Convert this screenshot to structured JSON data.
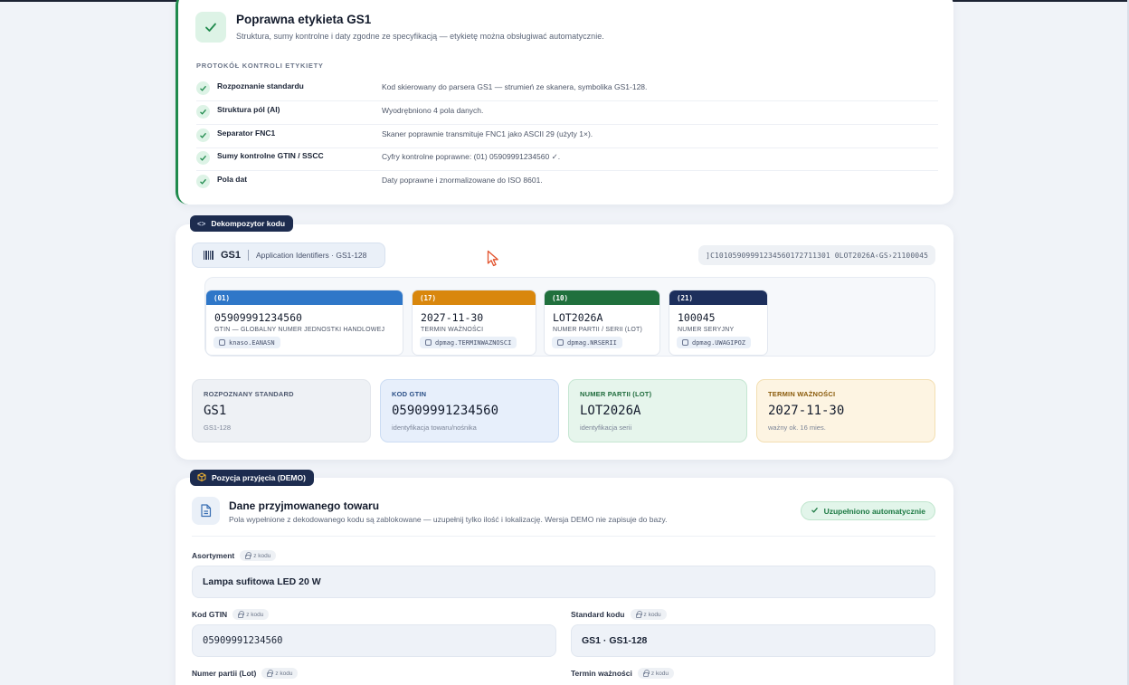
{
  "validation": {
    "title": "Poprawna etykieta GS1",
    "subtitle": "Struktura, sumy kontrolne i daty zgodne ze specyfikacją — etykietę można obsługiwać automatycznie.",
    "protocol_label": "PROTOKÓŁ KONTROLI ETYKIETY",
    "checks": [
      {
        "name": "Rozpoznanie standardu",
        "desc": "Kod skierowany do parsera GS1 — strumień ze skanera, symbolika GS1-128."
      },
      {
        "name": "Struktura pól (AI)",
        "desc": "Wyodrębniono 4 pola danych."
      },
      {
        "name": "Separator FNC1",
        "desc": "Skaner poprawnie transmituje FNC1 jako ASCII 29 (użyty 1×)."
      },
      {
        "name": "Sumy kontrolne GTIN / SSCC",
        "desc": "Cyfry kontrolne poprawne: (01) 05909991234560 ✓."
      },
      {
        "name": "Pola dat",
        "desc": "Daty poprawne i znormalizowane do ISO 8601."
      }
    ]
  },
  "decoder": {
    "pill": "Dekompozytor kodu",
    "standard": "GS1",
    "standard_desc": "Application Identifiers · GS1-128",
    "raw": "]C10105909991234560172711301 0LOT2026A‹GS›21100045",
    "ais": [
      {
        "ai": "(01)",
        "value": "05909991234560",
        "label": "GTIN — GLOBALNY NUMER JEDNOSTKI HANDLOWEJ",
        "field": "knaso.EANASN",
        "color": "#2f77c8"
      },
      {
        "ai": "(17)",
        "value": "2027-11-30",
        "label": "TERMIN WAŻNOŚCI",
        "field": "dpmag.TERMINWAZNOSCI",
        "color": "#d9870d"
      },
      {
        "ai": "(10)",
        "value": "LOT2026A",
        "label": "NUMER PARTII / SERII (LOT)",
        "field": "dpmag.NRSERII",
        "color": "#20703d"
      },
      {
        "ai": "(21)",
        "value": "100045",
        "label": "NUMER SERYJNY",
        "field": "dpmag.UWAGIPOZ",
        "color": "#1d2f5c"
      }
    ],
    "summary": [
      {
        "title": "ROZPOZNANY STANDARD",
        "value": "GS1",
        "sub": "GS1-128"
      },
      {
        "title": "KOD GTIN",
        "value": "05909991234560",
        "sub": "identyfikacja towaru/nośnika"
      },
      {
        "title": "NUMER PARTII (LOT)",
        "value": "LOT2026A",
        "sub": "identyfikacja serii"
      },
      {
        "title": "TERMIN WAŻNOŚCI",
        "value": "2027-11-30",
        "sub": "ważny ok. 16 mies."
      }
    ]
  },
  "form": {
    "pill": "Pozycja przyjęcia (DEMO)",
    "title": "Dane przyjmowanego towaru",
    "subtitle": "Pola wypełnione z dekodowanego kodu są zablokowane — uzupełnij tylko ilość i lokalizację. Wersja DEMO nie zapisuje do bazy.",
    "auto_badge": "Uzupełniono automatycznie",
    "lock_tag": "z kodu",
    "fields": {
      "asortyment": {
        "label": "Asortyment",
        "value": "Lampa sufitowa LED 20 W"
      },
      "gtin": {
        "label": "Kod GTIN",
        "value": "05909991234560"
      },
      "standard": {
        "label": "Standard kodu",
        "value": "GS1 · GS1-128"
      },
      "lot": {
        "label": "Numer partii (Lot)"
      },
      "termin": {
        "label": "Termin ważności"
      }
    }
  }
}
